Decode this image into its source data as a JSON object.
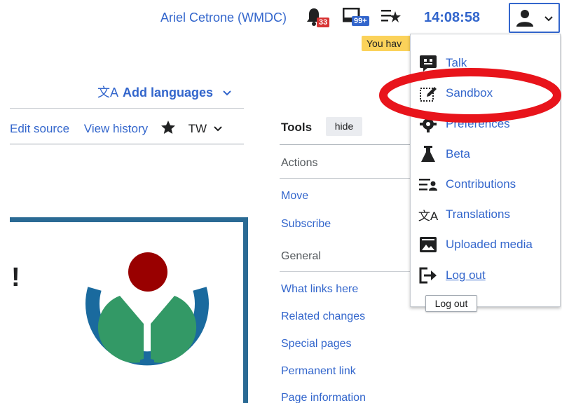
{
  "header": {
    "username": "Ariel Cetrone (WMDC)",
    "alerts_count": "33",
    "notices_count": "99+",
    "clock": "14:08:58",
    "user_menu_icon": "user-icon"
  },
  "yellow_tooltip": "You hav",
  "content": {
    "add_languages": "Add languages",
    "tabs": {
      "edit_source": "Edit source",
      "view_history": "View history",
      "tw": "TW"
    },
    "exclamation": "!"
  },
  "tools": {
    "title": "Tools",
    "hide": "hide",
    "sections": {
      "actions": "Actions",
      "general": "General"
    },
    "actions_links": [
      "Move",
      "Subscribe"
    ],
    "general_links": [
      "What links here",
      "Related changes",
      "Special pages",
      "Permanent link",
      "Page information"
    ]
  },
  "user_menu": {
    "items": [
      {
        "label": "Talk",
        "icon": "talk-icon"
      },
      {
        "label": "Sandbox",
        "icon": "sandbox-icon"
      },
      {
        "label": "Preferences",
        "icon": "gear-icon"
      },
      {
        "label": "Beta",
        "icon": "flask-icon"
      },
      {
        "label": "Contributions",
        "icon": "contributions-icon"
      },
      {
        "label": "Translations",
        "icon": "translate-icon"
      },
      {
        "label": "Uploaded media",
        "icon": "media-icon"
      },
      {
        "label": "Log out",
        "icon": "logout-icon"
      }
    ],
    "logout_tooltip": "Log out"
  },
  "colors": {
    "link": "#3366cc",
    "highlight_ring": "#e8141b",
    "badge_red": "#d73333",
    "badge_blue": "#3366cc",
    "logo_blue": "#1a6a9e",
    "logo_green": "#339966",
    "logo_red": "#990000"
  }
}
